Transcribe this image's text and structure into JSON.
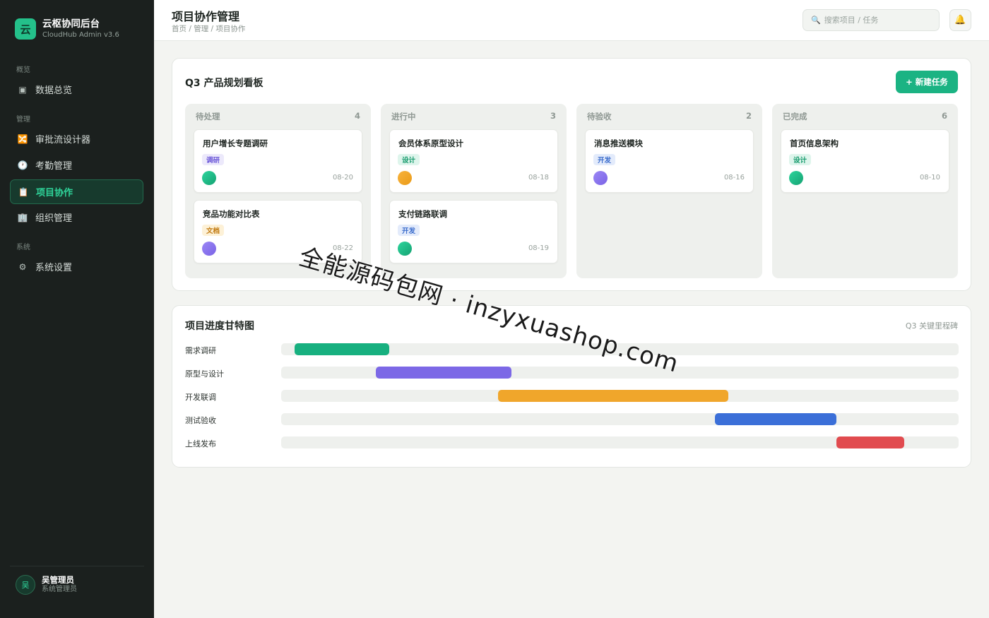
{
  "brand": {
    "logo_char": "云",
    "name": "云枢协同后台",
    "subtitle": "CloudHub Admin v3.6"
  },
  "nav": {
    "sections": [
      "概览",
      "管理",
      "系统"
    ],
    "items": [
      {
        "label": "数据总览",
        "icon": "dashboard-icon",
        "glyph": "▣",
        "active": false
      },
      {
        "label": "审批流设计器",
        "icon": "workflow-icon",
        "glyph": "🔀",
        "active": false
      },
      {
        "label": "考勤管理",
        "icon": "clock-icon",
        "glyph": "🕐",
        "active": false
      },
      {
        "label": "项目协作",
        "icon": "clipboard-icon",
        "glyph": "📋",
        "active": true
      },
      {
        "label": "组织管理",
        "icon": "building-icon",
        "glyph": "🏢",
        "active": false
      },
      {
        "label": "系统设置",
        "icon": "gear-icon",
        "glyph": "⚙",
        "active": false
      }
    ]
  },
  "user": {
    "avatar_char": "吴",
    "name": "吴管理员",
    "role": "系统管理员"
  },
  "header": {
    "title": "项目协作管理",
    "breadcrumb": "首页 / 管理 / 项目协作",
    "search_placeholder": "搜索项目 / 任务",
    "search_glyph": "🔍",
    "bell_glyph": "🔔"
  },
  "kanban": {
    "title": "Q3 产品规划看板",
    "new_button": "+ 新建任务",
    "columns": [
      {
        "name": "待处理",
        "count": "4",
        "tasks": [
          {
            "title": "用户增长专题调研",
            "tag": "调研",
            "tag_type": "research",
            "avatar_color": "green",
            "date": "08-20"
          },
          {
            "title": "竞品功能对比表",
            "tag": "文档",
            "tag_type": "doc",
            "avatar_color": "purple",
            "date": "08-22"
          }
        ]
      },
      {
        "name": "进行中",
        "count": "3",
        "tasks": [
          {
            "title": "会员体系原型设计",
            "tag": "设计",
            "tag_type": "design",
            "avatar_color": "orange",
            "date": "08-18"
          },
          {
            "title": "支付链路联调",
            "tag": "开发",
            "tag_type": "dev",
            "avatar_color": "green",
            "date": "08-19"
          }
        ]
      },
      {
        "name": "待验收",
        "count": "2",
        "tasks": [
          {
            "title": "消息推送模块",
            "tag": "开发",
            "tag_type": "dev",
            "avatar_color": "purple",
            "date": "08-16"
          }
        ]
      },
      {
        "name": "已完成",
        "count": "6",
        "tasks": [
          {
            "title": "首页信息架构",
            "tag": "设计",
            "tag_type": "design",
            "avatar_color": "green",
            "date": "08-10"
          }
        ]
      }
    ]
  },
  "gantt": {
    "title": "项目进度甘特图",
    "note": "Q3 关键里程碑",
    "rows": [
      {
        "label": "需求调研",
        "start": 0.02,
        "end": 0.16,
        "color": "#17b07f"
      },
      {
        "label": "原型与设计",
        "start": 0.14,
        "end": 0.34,
        "color": "#7c68e6"
      },
      {
        "label": "开发联调",
        "start": 0.32,
        "end": 0.66,
        "color": "#f0a62b"
      },
      {
        "label": "测试验收",
        "start": 0.64,
        "end": 0.82,
        "color": "#3b6fd8"
      },
      {
        "label": "上线发布",
        "start": 0.82,
        "end": 0.92,
        "color": "#e14b4f"
      }
    ]
  },
  "watermark": "全能源码包网 · inzyxuashop.com"
}
